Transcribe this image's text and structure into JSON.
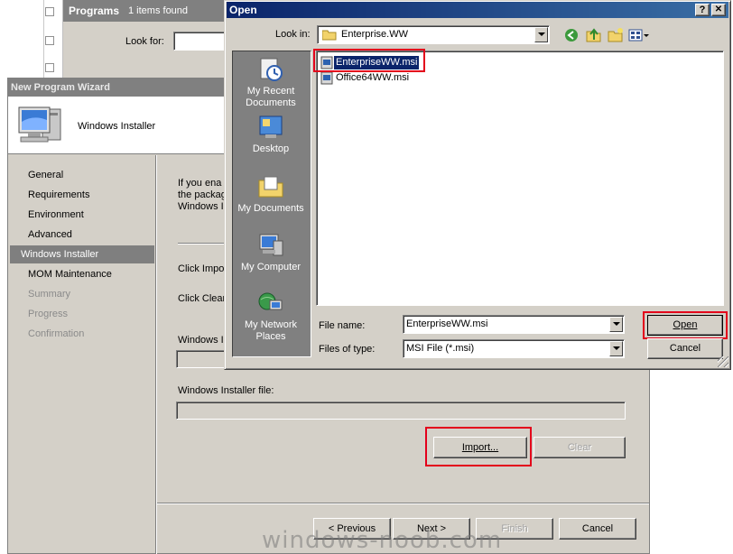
{
  "programs_panel": {
    "title": "Programs",
    "count": "1 items found",
    "look_for_label": "Look for:"
  },
  "wizard": {
    "title": "New Program Wizard",
    "header_label": "Windows Installer",
    "nav": [
      {
        "label": "General",
        "state": "normal"
      },
      {
        "label": "Requirements",
        "state": "normal"
      },
      {
        "label": "Environment",
        "state": "normal"
      },
      {
        "label": "Advanced",
        "state": "normal"
      },
      {
        "label": "Windows Installer",
        "state": "selected"
      },
      {
        "label": "MOM Maintenance",
        "state": "normal"
      },
      {
        "label": "Summary",
        "state": "disabled"
      },
      {
        "label": "Progress",
        "state": "disabled"
      },
      {
        "label": "Confirmation",
        "state": "disabled"
      }
    ],
    "body_lines": [
      "If you ena",
      "the packag",
      "Windows I"
    ],
    "click_import_text": "Click Impor",
    "click_clear_text": "Click Clear",
    "windows_i_label": "Windows I",
    "installer_file_label": "Windows Installer file:",
    "import_button": "Import...",
    "clear_button": "Clear",
    "prev_button": "< Previous",
    "next_button": "Next >",
    "finish_button": "Finish",
    "cancel_button": "Cancel"
  },
  "open_dialog": {
    "title": "Open",
    "help_button": "?",
    "close_button": "✕",
    "look_in_label": "Look in:",
    "look_in_value": "Enterprise.WW",
    "places": [
      "My Recent Documents",
      "Desktop",
      "My Documents",
      "My Computer",
      "My Network Places"
    ],
    "files": [
      "EnterpriseWW.msi",
      "Office64WW.msi"
    ],
    "file_name_label": "File name:",
    "file_name_value": "EnterpriseWW.msi",
    "files_of_type_label": "Files of type:",
    "files_of_type_value": "MSI File (*.msi)",
    "open_button": "Open",
    "cancel_button": "Cancel"
  },
  "watermark": "windows-noob.com"
}
